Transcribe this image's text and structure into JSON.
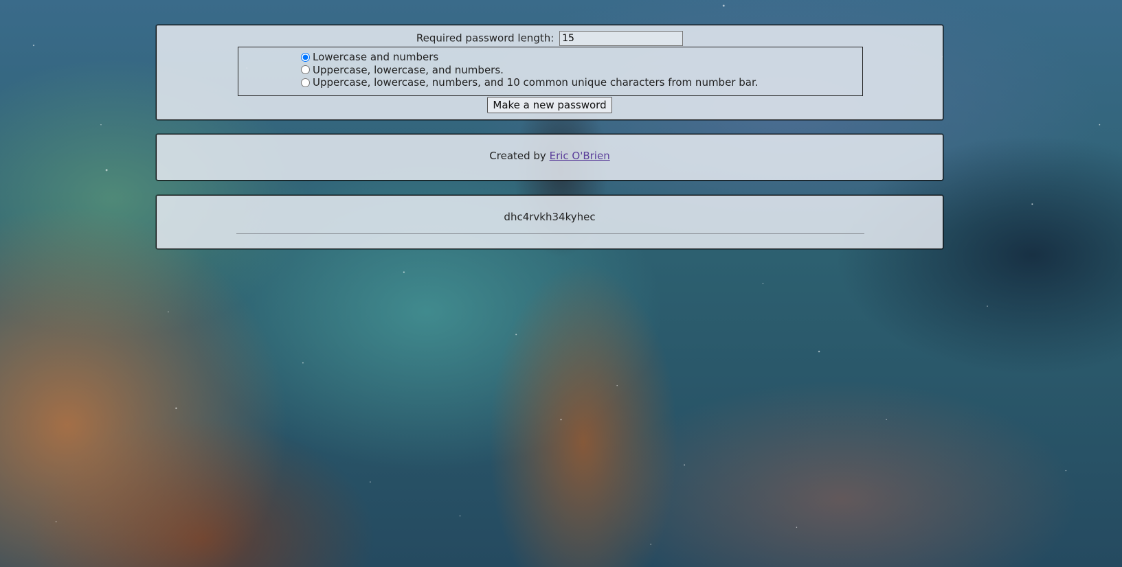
{
  "form": {
    "length_label": "Required password length:",
    "length_value": "15",
    "options": [
      {
        "label": "Lowercase and numbers",
        "selected": true
      },
      {
        "label": "Uppercase, lowercase, and numbers.",
        "selected": false
      },
      {
        "label": "Uppercase, lowercase, numbers, and 10 common unique characters from number bar.",
        "selected": false
      }
    ],
    "generate_button": "Make a new password"
  },
  "credit": {
    "prefix": "Created by",
    "author_link": "Eric O'Brien"
  },
  "output": {
    "password": "dhc4rvkh34kyhec"
  },
  "colors": {
    "panel_background": "#e4e9f0",
    "link": "#5b3f9a"
  }
}
